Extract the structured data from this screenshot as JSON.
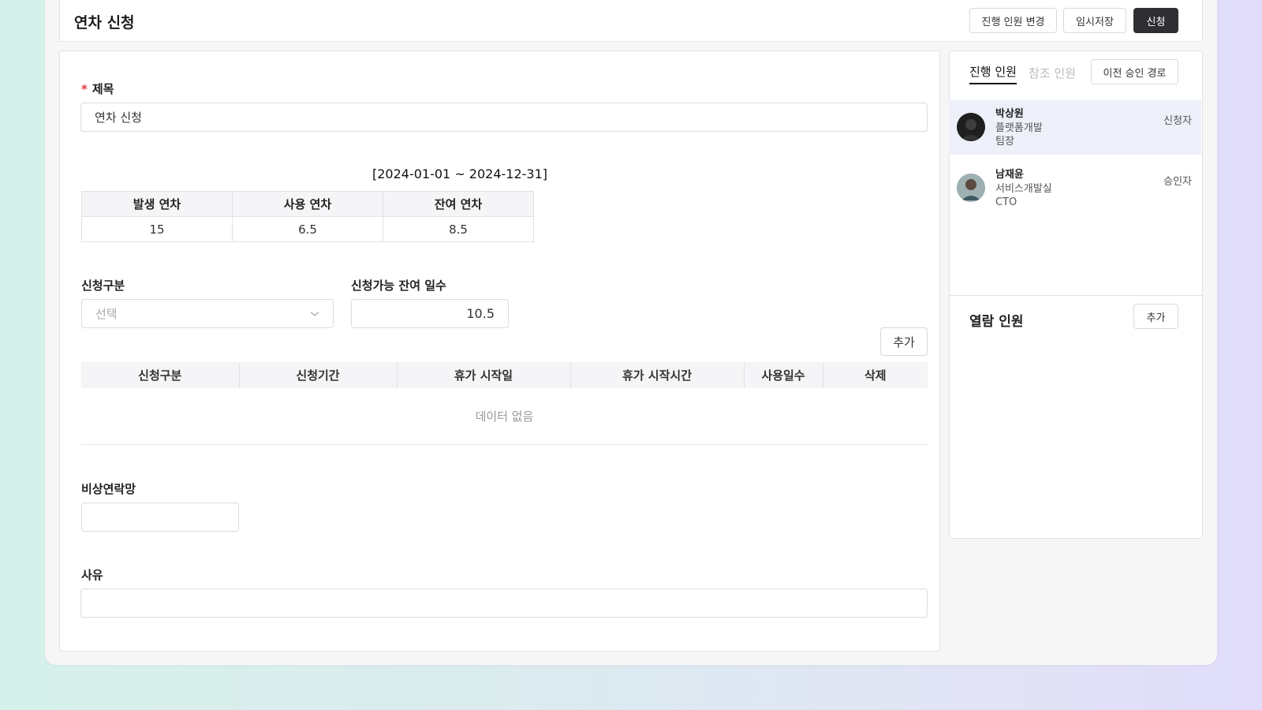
{
  "header": {
    "title": "연차 신청",
    "change_people_label": "진행 인원 변경",
    "save_draft_label": "임시저장",
    "submit_label": "신청"
  },
  "form": {
    "subject_label": "제목",
    "subject_value": "연차 신청",
    "period": "[2024-01-01 ~ 2024-12-31]",
    "summary_headers": [
      "발생 연차",
      "사용 연차",
      "잔여 연차"
    ],
    "summary_values": [
      "15",
      "6.5",
      "8.5"
    ],
    "type_label": "신청구분",
    "type_placeholder": "선택",
    "remaining_label": "신청가능 잔여 일수",
    "remaining_value": "10.5",
    "add_label": "추가",
    "table_headers": [
      "신청구분",
      "신청기간",
      "휴가 시작일",
      "휴가 시작시간",
      "사용일수",
      "삭제"
    ],
    "empty_text": "데이터 없음",
    "emergency_label": "비상연락망",
    "emergency_value": "",
    "reason_label": "사유",
    "reason_value": ""
  },
  "sidebar": {
    "tab_active": "진행 인원",
    "tab_inactive": "참조 인원",
    "prev_route_label": "이전 승인 경로",
    "people": [
      {
        "name": "박상원",
        "dept": "플랫폼개발",
        "title": "팀장",
        "role": "신청자"
      },
      {
        "name": "남재윤",
        "dept": "서비스개발실",
        "title": "CTO",
        "role": "승인자"
      }
    ],
    "viewers_label": "열람 인원",
    "viewers_add_label": "추가"
  },
  "colors": {
    "accent_dark": "#2f2f33",
    "required": "#e0373d",
    "selected_row": "#eef0f9"
  }
}
